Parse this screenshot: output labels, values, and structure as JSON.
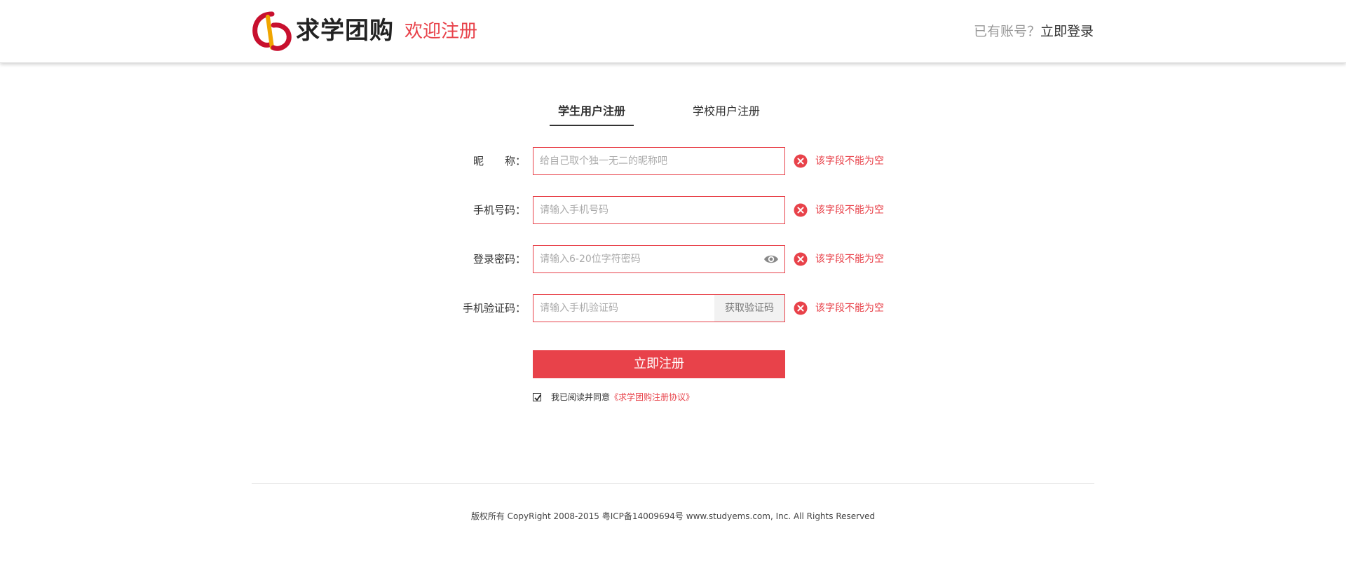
{
  "header": {
    "brand": "求学团购",
    "welcome": "欢迎注册",
    "have_account": "已有账号？",
    "login_link": "立即登录"
  },
  "tabs": [
    {
      "label": "学生用户注册",
      "active": true
    },
    {
      "label": "学校用户注册",
      "active": false
    }
  ],
  "form": {
    "nickname": {
      "label": "昵　　称：",
      "placeholder": "给自己取个独一无二的昵称吧",
      "error": "该字段不能为空"
    },
    "phone": {
      "label": "手机号码：",
      "placeholder": "请输入手机号码",
      "error": "该字段不能为空"
    },
    "password": {
      "label": "登录密码：",
      "placeholder": "请输入6-20位字符密码",
      "error": "该字段不能为空"
    },
    "sms_code": {
      "label": "手机验证码：",
      "placeholder": "请输入手机验证码",
      "button": "获取验证码",
      "error": "该字段不能为空"
    },
    "submit_label": "立即注册",
    "agreement": {
      "text": "我已阅读并同意",
      "link": "《求学团购注册协议》",
      "checked": true
    }
  },
  "footer": {
    "copyright": "版权所有 CopyRight 2008-2015 粤ICP备14009694号 www.studyems.com, Inc. All Rights Reserved"
  },
  "colors": {
    "accent": "#e8424a",
    "logo_red": "#c8102e",
    "logo_gold": "#f0a500"
  },
  "icons": {
    "error": "error-circle-icon",
    "eye": "eye-icon",
    "check": "checkmark-icon"
  }
}
